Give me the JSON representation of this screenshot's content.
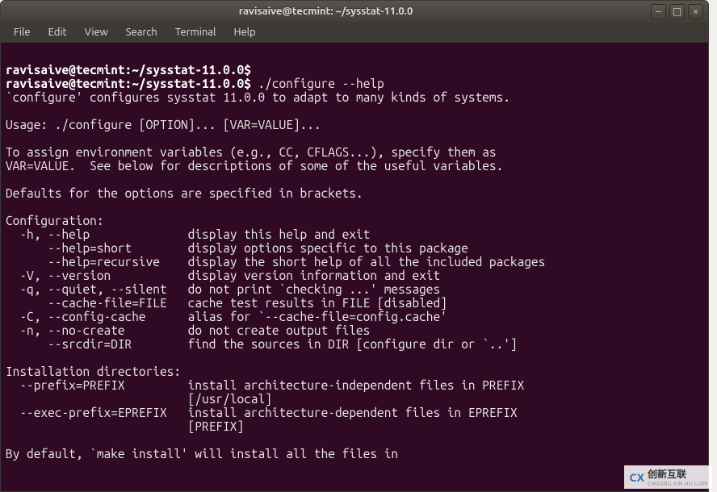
{
  "window": {
    "title": "ravisaive@tecmint: ~/sysstat-11.0.0"
  },
  "win_buttons": {
    "min": "–",
    "max": "□",
    "close": "×"
  },
  "menubar": [
    "File",
    "Edit",
    "View",
    "Search",
    "Terminal",
    "Help"
  ],
  "prompt1": "ravisaive@tecmint:~/sysstat-11.0.0$",
  "cmd1_rest": " ",
  "prompt2": "ravisaive@tecmint:~/sysstat-11.0.0$",
  "cmd2_rest": " ./configure --help",
  "body": "`configure' configures sysstat 11.0.0 to adapt to many kinds of systems.\n\nUsage: ./configure [OPTION]... [VAR=VALUE]...\n\nTo assign environment variables (e.g., CC, CFLAGS...), specify them as\nVAR=VALUE.  See below for descriptions of some of the useful variables.\n\nDefaults for the options are specified in brackets.\n\nConfiguration:\n  -h, --help              display this help and exit\n      --help=short        display options specific to this package\n      --help=recursive    display the short help of all the included packages\n  -V, --version           display version information and exit\n  -q, --quiet, --silent   do not print `checking ...' messages\n      --cache-file=FILE   cache test results in FILE [disabled]\n  -C, --config-cache      alias for `--cache-file=config.cache'\n  -n, --no-create         do not create output files\n      --srcdir=DIR        find the sources in DIR [configure dir or `..']\n\nInstallation directories:\n  --prefix=PREFIX         install architecture-independent files in PREFIX\n                          [/usr/local]\n  --exec-prefix=EPREFIX   install architecture-dependent files in EPREFIX\n                          [PREFIX]\n\nBy default, `make install' will install all the files in",
  "watermark": {
    "logo": "CX",
    "cn": "创新互联",
    "py": "CHUANG XIN HU LIAN"
  }
}
